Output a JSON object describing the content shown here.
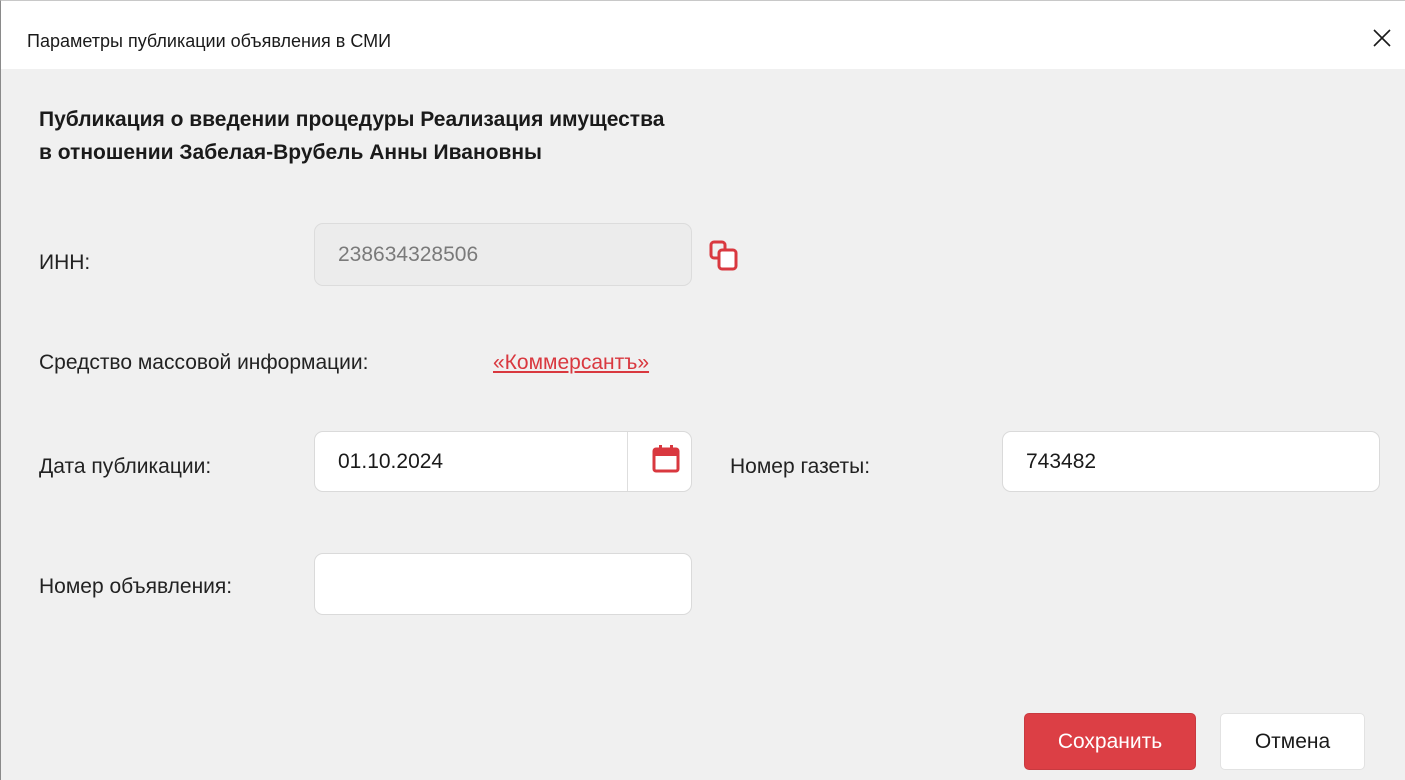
{
  "window": {
    "title": "Параметры публикации объявления в СМИ"
  },
  "heading": {
    "line1": "Публикация о введении процедуры Реализация имущества",
    "line2": "в отношении Забелая-Врубель Анны Ивановны"
  },
  "form": {
    "inn_label": "ИНН:",
    "inn_value": "238634328506",
    "media_label": "Средство массовой информации:",
    "media_value": "«Коммерсантъ»",
    "date_label": "Дата публикации:",
    "date_value": "01.10.2024",
    "newspaper_label": "Номер газеты:",
    "newspaper_value": "743482",
    "ad_number_label": "Номер объявления:",
    "ad_number_value": ""
  },
  "buttons": {
    "save": "Сохранить",
    "cancel": "Отмена"
  },
  "icons": {
    "close": "close-icon",
    "copy": "copy-icon",
    "calendar": "calendar-icon"
  },
  "colors": {
    "accent": "#dc3f45",
    "link": "#d9383f"
  }
}
